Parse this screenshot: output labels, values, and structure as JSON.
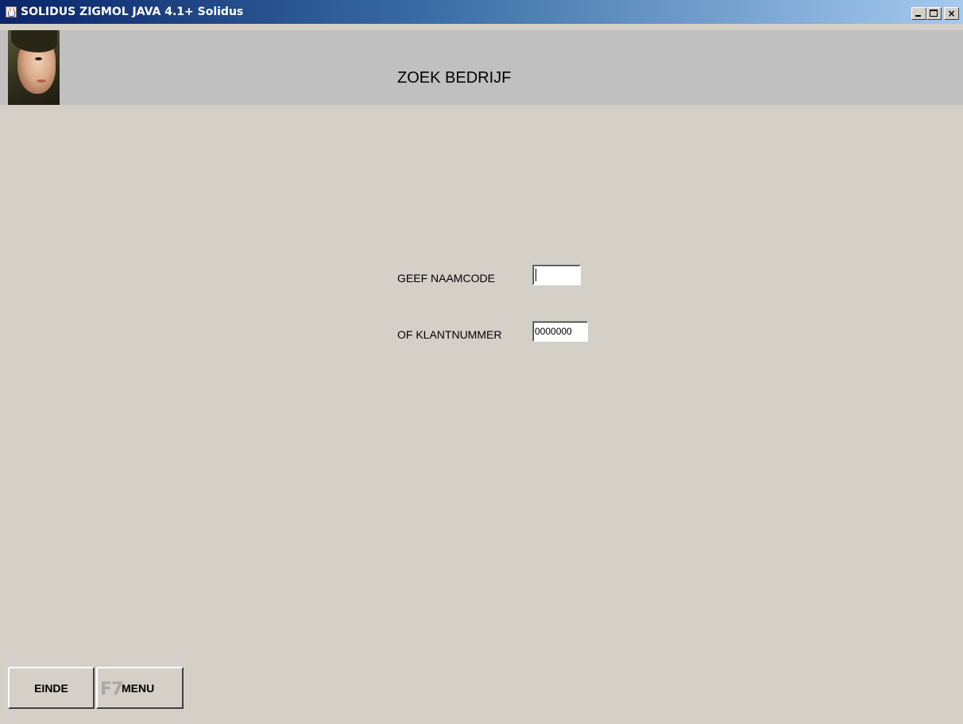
{
  "window": {
    "title": "SOLIDUS ZIGMOL JAVA 4.1+ Solidus",
    "controls": {
      "minimize": "minimize",
      "maximize": "maximize",
      "close": "×"
    }
  },
  "header": {
    "title": "ZOEK BEDRIJF",
    "band_color": "#c0c0c0"
  },
  "form": {
    "naamcode": {
      "label": "GEEF NAAMCODE",
      "value": ""
    },
    "klantnummer": {
      "label": "OF KLANTNUMMER",
      "value": "0000000"
    }
  },
  "footer": {
    "einde_label": "EINDE",
    "menu_key": "F7",
    "menu_label": "MENU"
  },
  "colors": {
    "background": "#d4d0c8",
    "titlebar_start": "#0a246a",
    "titlebar_end": "#a6caf0"
  },
  "icons": {
    "app": "java-cup-icon",
    "avatar": "user-photo"
  }
}
